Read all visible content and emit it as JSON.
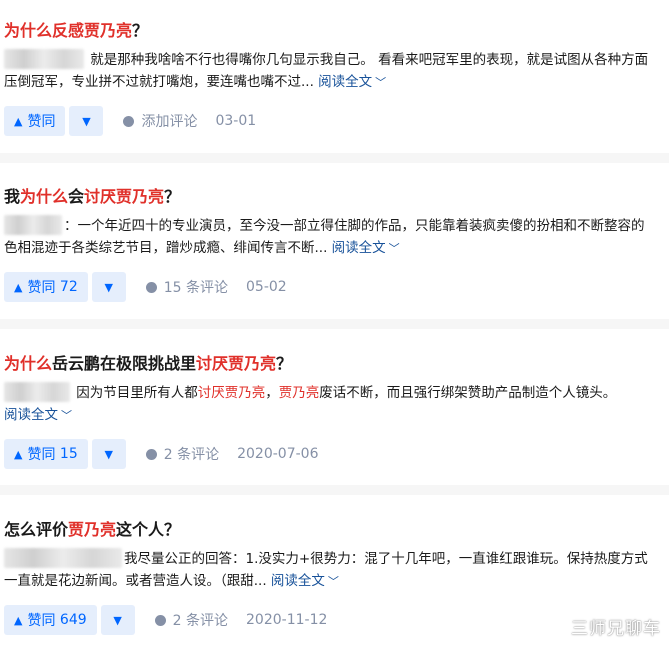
{
  "answers": [
    {
      "title_parts": [
        {
          "t": "为什么反感贾乃亮",
          "hl": true
        },
        {
          "t": "？",
          "hl": false
        }
      ],
      "excerpt_parts": [
        {
          "t": " 就是那种我啥啥不行也得嘴你几句显示我自己。 看看来吧冠军里的表现，就是试图从各种方面压倒冠军，专业拼不过就打嘴炮，要连嘴也嘴不过...",
          "hl": false
        }
      ],
      "read_more": "阅读全文",
      "vote_label": "赞同",
      "vote_count": "",
      "comment_label": "添加评论",
      "date": "03-01"
    },
    {
      "title_parts": [
        {
          "t": "我",
          "hl": false
        },
        {
          "t": "为什么",
          "hl": true
        },
        {
          "t": "会",
          "hl": false
        },
        {
          "t": "讨厌贾乃亮",
          "hl": true
        },
        {
          "t": "？",
          "hl": false
        }
      ],
      "excerpt_parts": [
        {
          "t": "：一个年近四十的专业演员，至今没一部立得住脚的作品，只能靠着装疯卖傻的扮相和不断整容的色相混迹于各类综艺节目，蹭炒成瘾、绯闻传言不断...",
          "hl": false
        }
      ],
      "read_more": "阅读全文",
      "vote_label": "赞同",
      "vote_count": "72",
      "comment_label": "15 条评论",
      "date": "05-02"
    },
    {
      "title_parts": [
        {
          "t": "为什么",
          "hl": true
        },
        {
          "t": "岳云鹏在极限挑战里",
          "hl": false
        },
        {
          "t": "讨厌贾乃亮",
          "hl": true
        },
        {
          "t": "？",
          "hl": false
        }
      ],
      "excerpt_parts": [
        {
          "t": " 因为节目里所有人都",
          "hl": false
        },
        {
          "t": "讨厌贾乃亮",
          "hl": true
        },
        {
          "t": "，",
          "hl": false
        },
        {
          "t": "贾乃亮",
          "hl": true
        },
        {
          "t": "废话不断，而且强行绑架赞助产品制造个人镜头。",
          "hl": false
        }
      ],
      "read_more": "阅读全文",
      "vote_label": "赞同",
      "vote_count": "15",
      "comment_label": "2 条评论",
      "date": "2020-07-06"
    },
    {
      "title_parts": [
        {
          "t": "怎么评价",
          "hl": false
        },
        {
          "t": "贾乃亮",
          "hl": true
        },
        {
          "t": "这个人？",
          "hl": false
        }
      ],
      "excerpt_parts": [
        {
          "t": "我尽量公正的回答：1.没实力+很势力：混了十几年吧，一直谁红跟谁玩。保持热度方式一直就是花边新闻。或者营造人设。（跟甜...",
          "hl": false
        }
      ],
      "read_more": "阅读全文",
      "vote_label": "赞同",
      "vote_count": "649",
      "comment_label": "2 条评论",
      "date": "2020-11-12"
    }
  ],
  "watermark": "三师兄聊车",
  "icons": {
    "vote_up": "triangle-up-icon",
    "vote_down": "triangle-down-icon",
    "comment": "comment-bubble-icon",
    "read_more": "chevron-down-icon"
  },
  "colors": {
    "highlight": "#e0302a",
    "link": "#175199",
    "vote": "#0066ff",
    "vote_bg": "#e5eefc",
    "meta": "#8590a6"
  }
}
